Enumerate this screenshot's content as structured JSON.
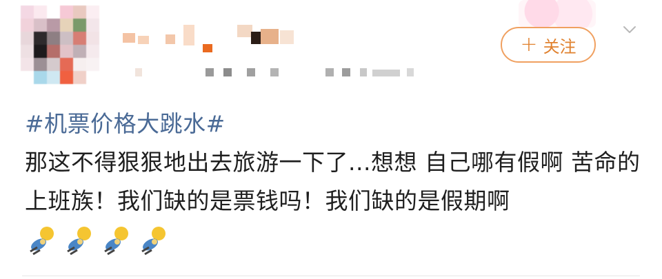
{
  "post": {
    "follow_button": {
      "plus": "+",
      "label": "关注"
    },
    "hashtag": "#机票价格大跳水#",
    "body_text": "那这不得狠狠地出去旅游一下了...想想 自己哪有假啊 苦命的上班族！我们缺的是票钱吗！我们缺的是假期啊",
    "emojis": [
      "sweat-running-emoji",
      "sweat-running-emoji",
      "sweat-running-emoji",
      "sweat-running-emoji"
    ]
  },
  "icons": {
    "follow": "plus-icon",
    "more": "chevron-down-icon"
  },
  "colors": {
    "hashtag": "#4a6a96",
    "follow_accent": "#e0812e",
    "text": "#1f1f1f"
  }
}
